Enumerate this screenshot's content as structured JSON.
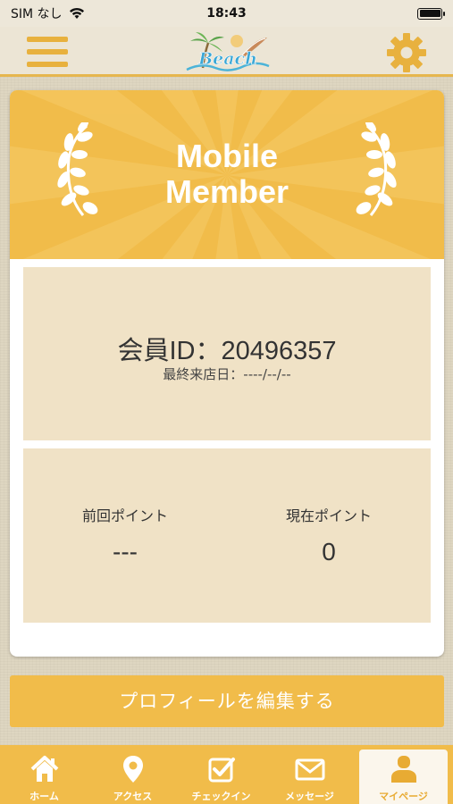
{
  "status_bar": {
    "carrier": "SIM なし",
    "time": "18:43"
  },
  "header": {
    "logo_text": "Beach",
    "menu_icon": "hamburger-icon",
    "settings_icon": "gear-icon"
  },
  "card": {
    "title_line1": "Mobile",
    "title_line2": "Member",
    "member_id": "会員ID：20496357",
    "last_visit": "最終来店日：----/--/--",
    "previous_points_label": "前回ポイント",
    "previous_points_value": "---",
    "current_points_label": "現在ポイント",
    "current_points_value": "0"
  },
  "edit_profile_label": "プロフィールを編集する",
  "tabs": [
    {
      "label": "ホーム",
      "icon": "home-icon"
    },
    {
      "label": "アクセス",
      "icon": "map-pin-icon"
    },
    {
      "label": "チェックイン",
      "icon": "checkbox-icon"
    },
    {
      "label": "メッセージ",
      "icon": "envelope-icon"
    },
    {
      "label": "マイページ",
      "icon": "person-icon",
      "active": true
    }
  ],
  "colors": {
    "accent": "#f1bc4a",
    "panel": "#f0e2c6",
    "background": "#ded6c1"
  }
}
